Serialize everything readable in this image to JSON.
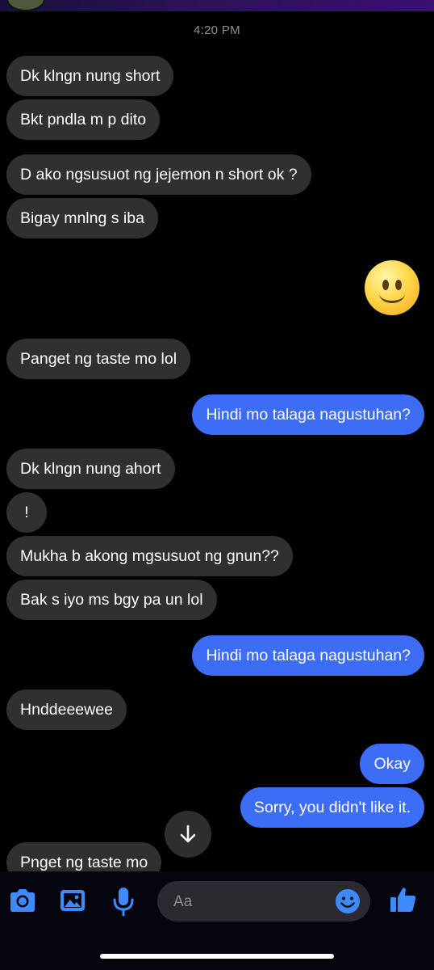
{
  "time_label": "4:20 PM",
  "messages": [
    {
      "text": "Dk klngn nung short"
    },
    {
      "text": "Bkt pndla m p dito"
    },
    {
      "text": "D ako ngsusuot ng jejemon n short ok ?"
    },
    {
      "text": "Bigay mnlng s iba"
    },
    {
      "text": "Panget ng taste mo lol"
    },
    {
      "text": "Hindi mo talaga nagustuhan?"
    },
    {
      "text": "Dk klngn nung ahort"
    },
    {
      "text": "!"
    },
    {
      "text": "Mukha b akong mgsusuot ng gnun??"
    },
    {
      "text": "Bak s iyo ms bgy pa un lol"
    },
    {
      "text": "Hindi mo talaga nagustuhan?"
    },
    {
      "text": "Hnddeeewee"
    },
    {
      "text": "Okay"
    },
    {
      "text": "Sorry, you didn't like it."
    },
    {
      "text": "Pnget ng taste mo"
    }
  ],
  "emoji_message": "slightly-smiling-face",
  "composer": {
    "placeholder": "Aa",
    "icons": [
      "camera-icon",
      "gallery-icon",
      "microphone-icon",
      "emoji-icon",
      "thumbs-up-icon"
    ]
  },
  "colors": {
    "background": "#000000",
    "incoming_bubble": "#303030",
    "outgoing_bubble": "#3d6cf5",
    "accent": "#3d8bff"
  }
}
